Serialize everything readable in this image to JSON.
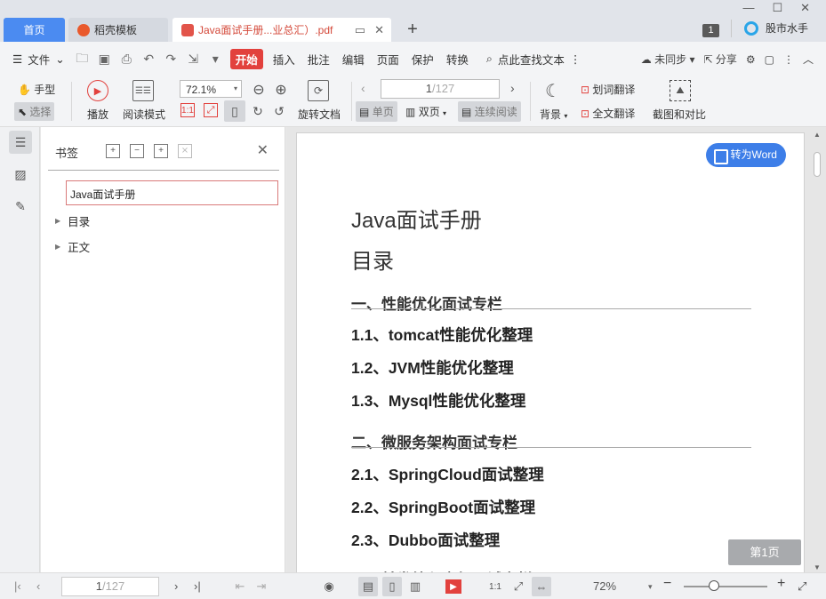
{
  "tabs": {
    "home": "首页",
    "templates": "稻壳模板",
    "pdf": "Java面试手册...业总汇）.pdf",
    "count": "1",
    "user": "股市水手"
  },
  "menu": {
    "file": "文件",
    "start": "开始",
    "items": [
      "插入",
      "批注",
      "编辑",
      "页面",
      "保护",
      "转换"
    ],
    "search": "点此查找文本",
    "sync": "未同步",
    "share": "分享"
  },
  "ribbon": {
    "hand": "手型",
    "select": "选择",
    "play": "播放",
    "read_mode": "阅读模式",
    "zoom": "72.1%",
    "rotate": "旋转文档",
    "page_current": "1",
    "page_total": "/127",
    "single": "单页",
    "double": "双页",
    "continuous": "连续阅读",
    "background": "背景",
    "word_translate": "划词翻译",
    "full_translate": "全文翻译",
    "screenshot": "截图和对比"
  },
  "panel": {
    "title": "书签",
    "root": "Java面试手册",
    "items": [
      "目录",
      "正文"
    ]
  },
  "doc": {
    "title": "Java面试手册",
    "toc": "目录",
    "sections": [
      {
        "heading": "一、性能优化面试专栏",
        "subs": [
          "1.1、tomcat性能优化整理",
          "1.2、JVM性能优化整理",
          "1.3、Mysql性能优化整理"
        ]
      },
      {
        "heading": "二、微服务架构面试专栏",
        "subs": [
          "2.1、SpringCloud面试整理",
          "2.2、SpringBoot面试整理",
          "2.3、Dubbo面试整理"
        ]
      },
      {
        "heading": "三、并发编程高级面试专栏",
        "subs": []
      }
    ],
    "to_word": "转为Word",
    "page_badge": "第1页"
  },
  "status": {
    "page_current": "1",
    "page_total": "/127",
    "zoom": "72%"
  },
  "colors": {
    "accent": "#4b8bf1",
    "brand_red": "#e2413d",
    "word_button": "#3d7ee8"
  }
}
